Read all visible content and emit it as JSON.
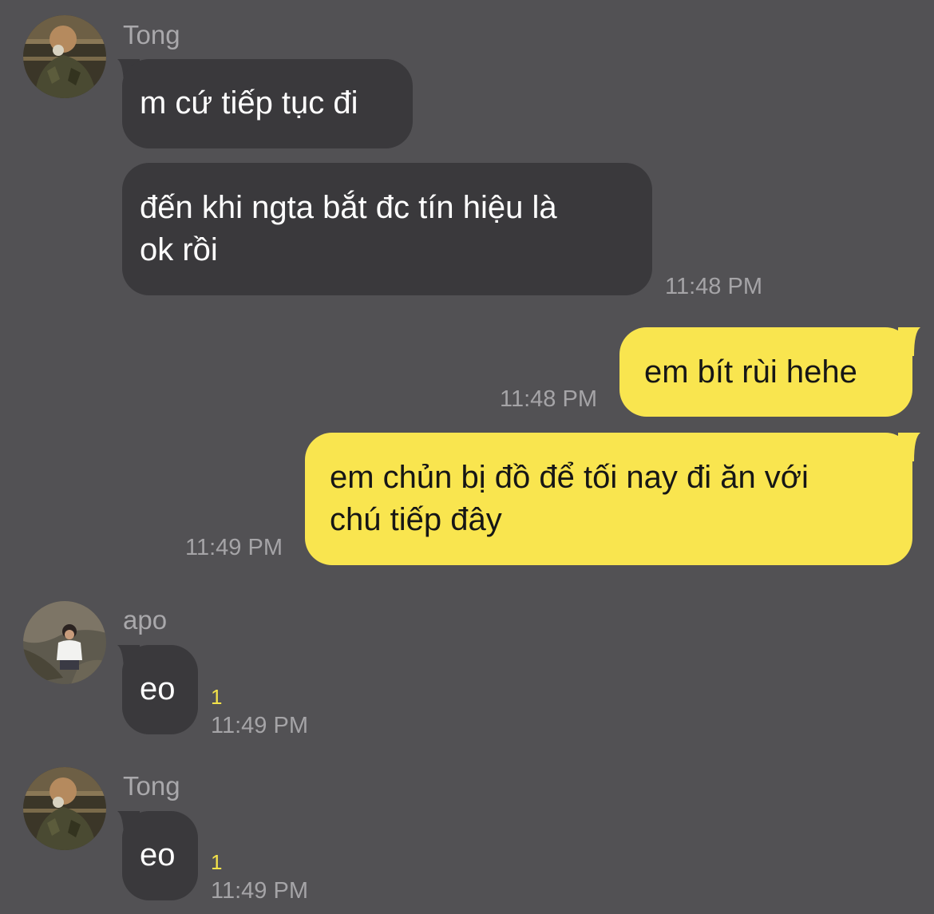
{
  "messages": [
    {
      "sender": "Tong",
      "avatar": "avatar-tong",
      "text": "m cứ tiếp tục đi"
    },
    {
      "text_line1": "đến khi ngta bắt đc tín hiệu là",
      "text_line2": "ok rồi",
      "time": "11:48 PM"
    },
    {
      "text": "em bít rùi hehe",
      "time": "11:48 PM"
    },
    {
      "text_line1": "em chủn bị đồ để tối nay đi ăn với",
      "text_line2": "chú tiếp đây",
      "time": "11:49 PM"
    },
    {
      "sender": "apo",
      "avatar": "avatar-apo",
      "text": "eo",
      "unread": "1",
      "time": "11:49 PM"
    },
    {
      "sender": "Tong",
      "avatar": "avatar-tong",
      "text": "eo",
      "unread": "1",
      "time": "11:49 PM"
    }
  ],
  "colors": {
    "background": "#525154",
    "incoming_bubble": "#3a393c",
    "outgoing_bubble": "#f9e54f",
    "unread_badge": "#f3e24a"
  }
}
